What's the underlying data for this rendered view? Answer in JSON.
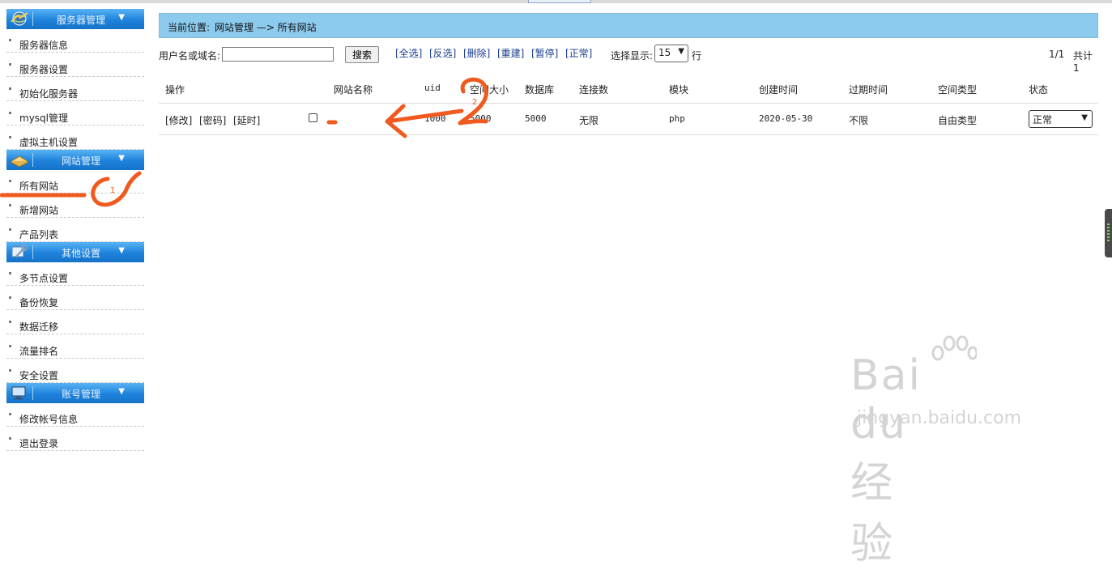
{
  "sidebar": {
    "sections": [
      {
        "title": "服务器管理",
        "icon": "globe-icon",
        "items": [
          "服务器信息",
          "服务器设置",
          "初始化服务器",
          "mysql管理",
          "虚拟主机设置"
        ]
      },
      {
        "title": "网站管理",
        "icon": "book-icon",
        "items": [
          "所有网站",
          "新增网站",
          "产品列表"
        ]
      },
      {
        "title": "其他设置",
        "icon": "tools-icon",
        "items": [
          "多节点设置",
          "备份恢复",
          "数据迁移",
          "流量排名",
          "安全设置"
        ]
      },
      {
        "title": "账号管理",
        "icon": "computer-icon",
        "items": [
          "修改帐号信息",
          "退出登录"
        ]
      }
    ]
  },
  "breadcrumb": {
    "label": "当前位置:",
    "path": "网站管理 —> 所有网站"
  },
  "toolbar": {
    "search_label": "用户名或域名:",
    "search_value": "",
    "search_button": "搜索",
    "actions": [
      "[全选]",
      "[反选]",
      "[删除]",
      "[重建]",
      "[暂停]",
      "[正常]"
    ],
    "display_label": "选择显示:",
    "display_value": "15",
    "display_unit": "行",
    "page_info": "1/1",
    "total": "共计1"
  },
  "table": {
    "headers": [
      "操作",
      "网站名称",
      "uid",
      "空间大小",
      "数据库",
      "连接数",
      "模块",
      "创建时间",
      "过期时间",
      "空间类型",
      "状态"
    ],
    "rows": [
      {
        "ops": [
          "[修改]",
          "[密码]",
          "[延时]"
        ],
        "name": "",
        "uid": "1000",
        "space": "5000",
        "db": "5000",
        "connections": "无限",
        "module": "php",
        "created": "2020-05-30",
        "expires": "不限",
        "space_type": "自由类型",
        "status": "正常"
      }
    ]
  },
  "annotation_marks": [
    "1",
    "2"
  ],
  "colors": {
    "header_blue": "#1e82dc",
    "breadcrumb_bg": "#8dcbee",
    "annotation": "#f05a1e"
  },
  "watermark": {
    "brand": "Bai du 经验",
    "url": "jingyan.baidu.com"
  }
}
